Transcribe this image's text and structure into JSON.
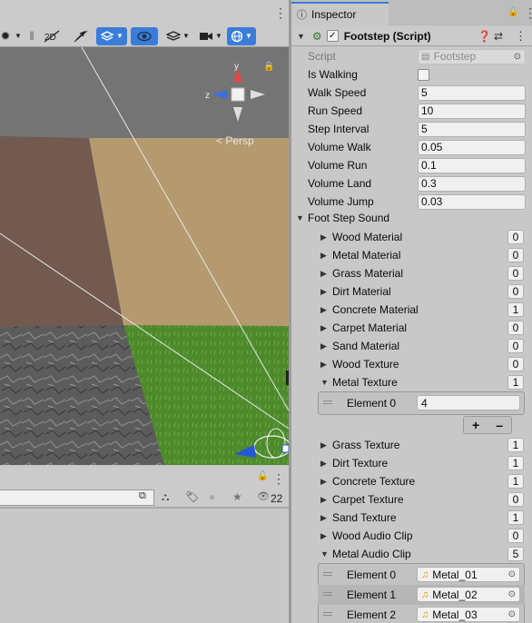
{
  "scene": {
    "persp_label": "< Persp",
    "gizmo_axes": {
      "y": "y",
      "z": "z"
    },
    "hierarchy_count": "22"
  },
  "inspector": {
    "tab_label": "Inspector",
    "component_title": "Footstep (Script)",
    "script_label": "Script",
    "script_value": "Footstep",
    "fields": [
      {
        "label": "Is Walking",
        "type": "checkbox",
        "value": ""
      },
      {
        "label": "Walk Speed",
        "type": "text",
        "value": "5"
      },
      {
        "label": "Run Speed",
        "type": "text",
        "value": "10"
      },
      {
        "label": "Step Interval",
        "type": "text",
        "value": "5"
      },
      {
        "label": "Volume Walk",
        "type": "text",
        "value": "0.05"
      },
      {
        "label": "Volume Run",
        "type": "text",
        "value": "0.1"
      },
      {
        "label": "Volume Land",
        "type": "text",
        "value": "0.3"
      },
      {
        "label": "Volume Jump",
        "type": "text",
        "value": "0.03"
      }
    ],
    "foldout_label": "Foot Step Sound",
    "lists_a": [
      {
        "label": "Wood Material",
        "size": "0"
      },
      {
        "label": "Metal Material",
        "size": "0"
      },
      {
        "label": "Grass Material",
        "size": "0"
      },
      {
        "label": "Dirt Material",
        "size": "0"
      },
      {
        "label": "Concrete Material",
        "size": "1"
      },
      {
        "label": "Carpet Material",
        "size": "0"
      },
      {
        "label": "Sand Material",
        "size": "0"
      },
      {
        "label": "Wood Texture",
        "size": "0"
      },
      {
        "label": "Metal Texture",
        "size": "1"
      }
    ],
    "metal_texture_element": {
      "label": "Element 0",
      "value": "4"
    },
    "plus": "+",
    "minus": "–",
    "lists_b": [
      {
        "label": "Grass Texture",
        "size": "1"
      },
      {
        "label": "Dirt Texture",
        "size": "1"
      },
      {
        "label": "Concrete Texture",
        "size": "1"
      },
      {
        "label": "Carpet Texture",
        "size": "0"
      },
      {
        "label": "Sand Texture",
        "size": "1"
      },
      {
        "label": "Wood Audio Clip",
        "size": "0"
      },
      {
        "label": "Metal Audio Clip",
        "size": "5"
      }
    ],
    "audio_elements": [
      {
        "label": "Element 0",
        "value": "Metal_01"
      },
      {
        "label": "Element 1",
        "value": "Metal_02"
      },
      {
        "label": "Element 2",
        "value": "Metal_03"
      }
    ]
  },
  "colors": {
    "accent": "#3a7cd8",
    "grass": "#4d8a2c",
    "sand": "#b49a6e",
    "dirt": "#725a50"
  }
}
